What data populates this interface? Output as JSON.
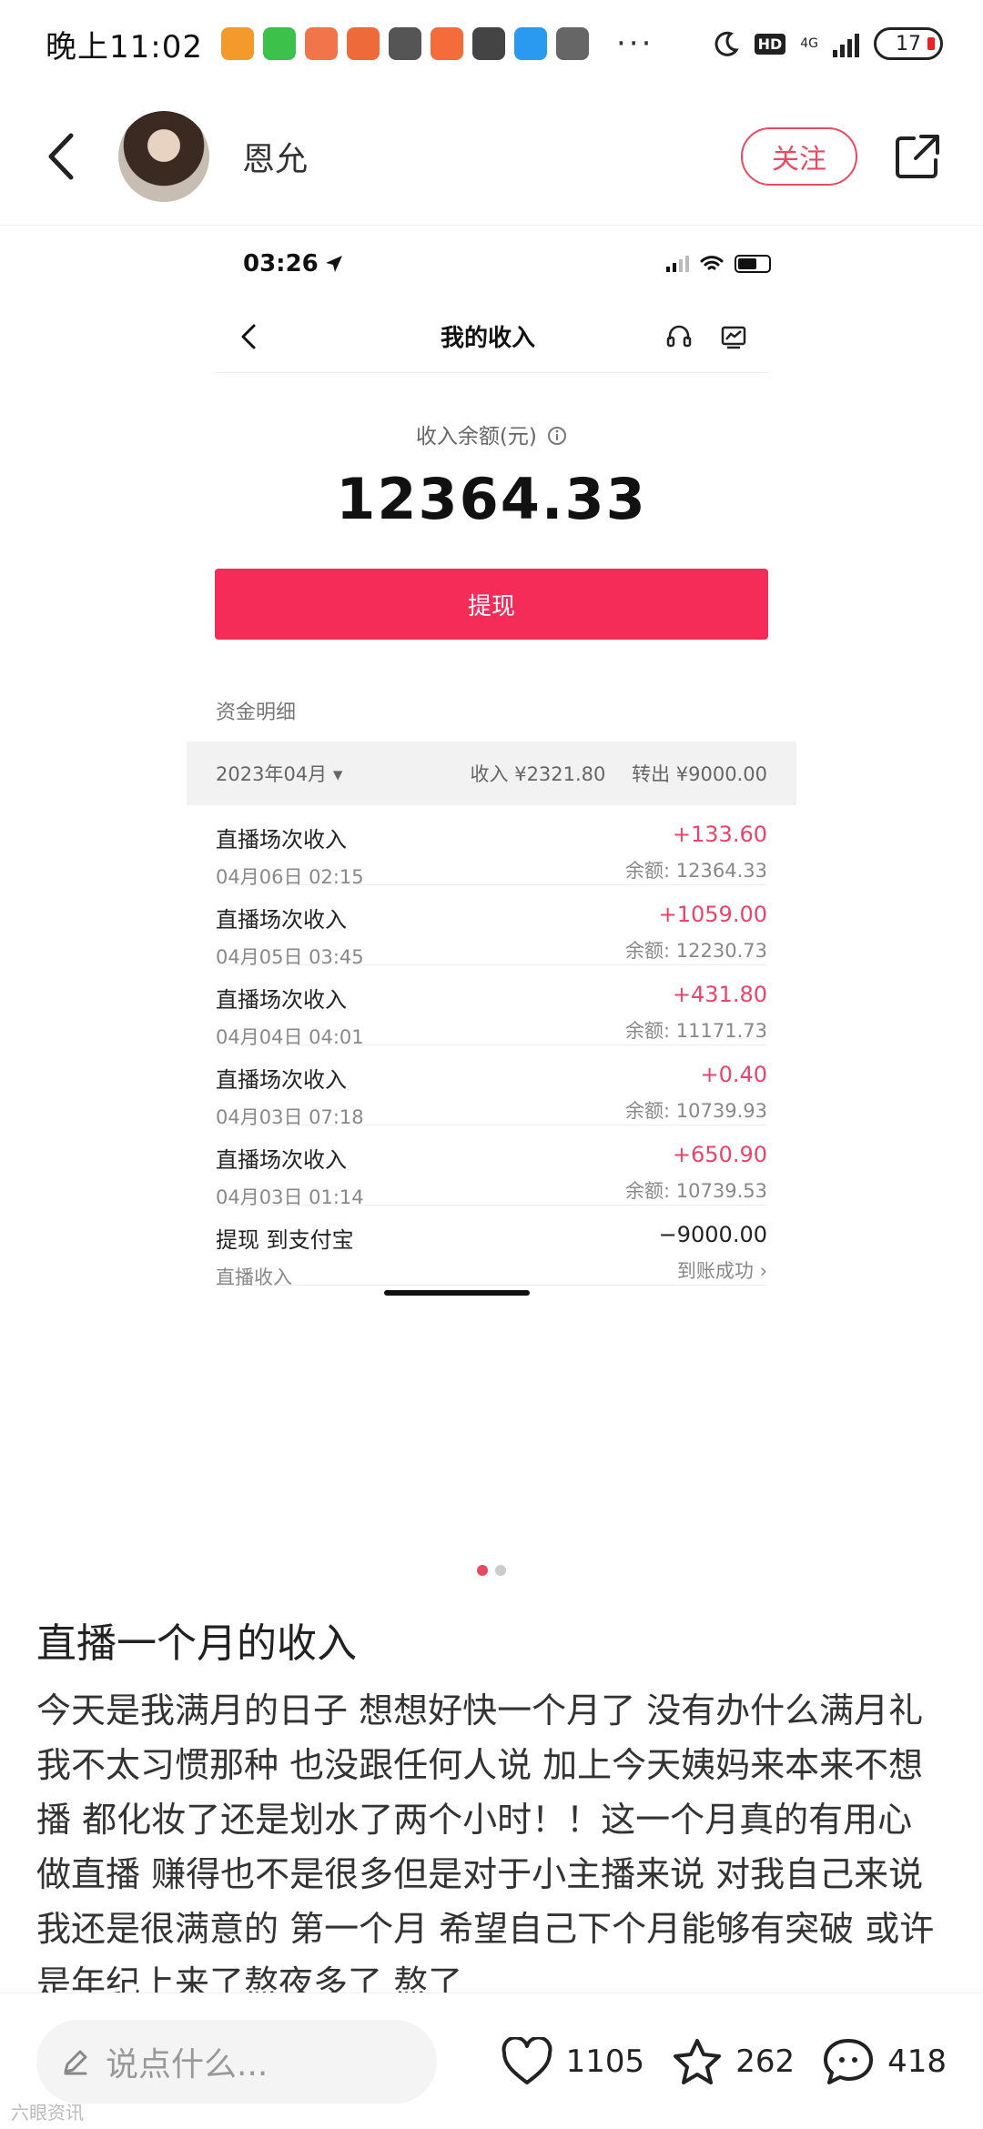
{
  "status_bar": {
    "time": "晚上11:02",
    "dots": "···",
    "hd": "HD",
    "network": "4G",
    "battery": "17",
    "app_icons": [
      {
        "name": "shield-app-icon",
        "color": "#f39a2b"
      },
      {
        "name": "wechat-app-icon",
        "color": "#3cc24a"
      },
      {
        "name": "store-app-icon",
        "color": "#f2744a"
      },
      {
        "name": "shop-app-icon",
        "color": "#ef6a3a"
      },
      {
        "name": "upload-app-icon",
        "color": "#555555"
      },
      {
        "name": "taobao-app-icon",
        "color": "#f56b3a"
      },
      {
        "name": "baidu-app-icon",
        "color": "#444444"
      },
      {
        "name": "blue-app-icon",
        "color": "#2a9af0"
      },
      {
        "name": "alarm-icon",
        "color": "#666666"
      }
    ]
  },
  "header": {
    "author": "恩允",
    "follow_label": "关注"
  },
  "screenshot": {
    "status_time": "03:26",
    "nav_title": "我的收入",
    "balance_label": "收入余额(元)",
    "balance_value": "12364.33",
    "withdraw_label": "提现",
    "detail_title": "资金明细",
    "month": "2023年04月 ▾",
    "income_summary": "收入 ¥2321.80",
    "transfer_summary": "转出 ¥9000.00",
    "transactions": [
      {
        "name": "直播场次收入",
        "date": "04月06日 02:15",
        "amount": "+133.60",
        "balance": "余额: 12364.33"
      },
      {
        "name": "直播场次收入",
        "date": "04月05日 03:45",
        "amount": "+1059.00",
        "balance": "余额: 12230.73"
      },
      {
        "name": "直播场次收入",
        "date": "04月04日 04:01",
        "amount": "+431.80",
        "balance": "余额: 11171.73"
      },
      {
        "name": "直播场次收入",
        "date": "04月03日 07:18",
        "amount": "+0.40",
        "balance": "余额: 10739.93"
      },
      {
        "name": "直播场次收入",
        "date": "04月03日 01:14",
        "amount": "+650.90",
        "balance": "余额: 10739.53"
      },
      {
        "name": "提现 到支付宝",
        "date": "直播收入",
        "amount": "−9000.00",
        "balance": "到账成功 ›"
      }
    ]
  },
  "post": {
    "title": "直播一个月的收入",
    "body": "今天是我满月的日子 想想好快一个月了 没有办什么满月礼我不太习惯那种 也没跟任何人说 加上今天姨妈来本来不想播 都化妆了还是划水了两个小时！！这一个月真的有用心做直播 赚得也不是很多但是对于小主播来说 对我自己来说 我还是很满意的 第一个月 希望自己下个月能够有突破 或许是年纪上来了熬夜多了 熬了"
  },
  "bottom_bar": {
    "comment_placeholder": "说点什么...",
    "likes": "1105",
    "favorites": "262",
    "comments": "418"
  },
  "watermark": "六眼资讯",
  "colors": {
    "accent": "#e84a5f",
    "withdraw_button": "#f52c58",
    "income_amount": "#e8456a"
  }
}
